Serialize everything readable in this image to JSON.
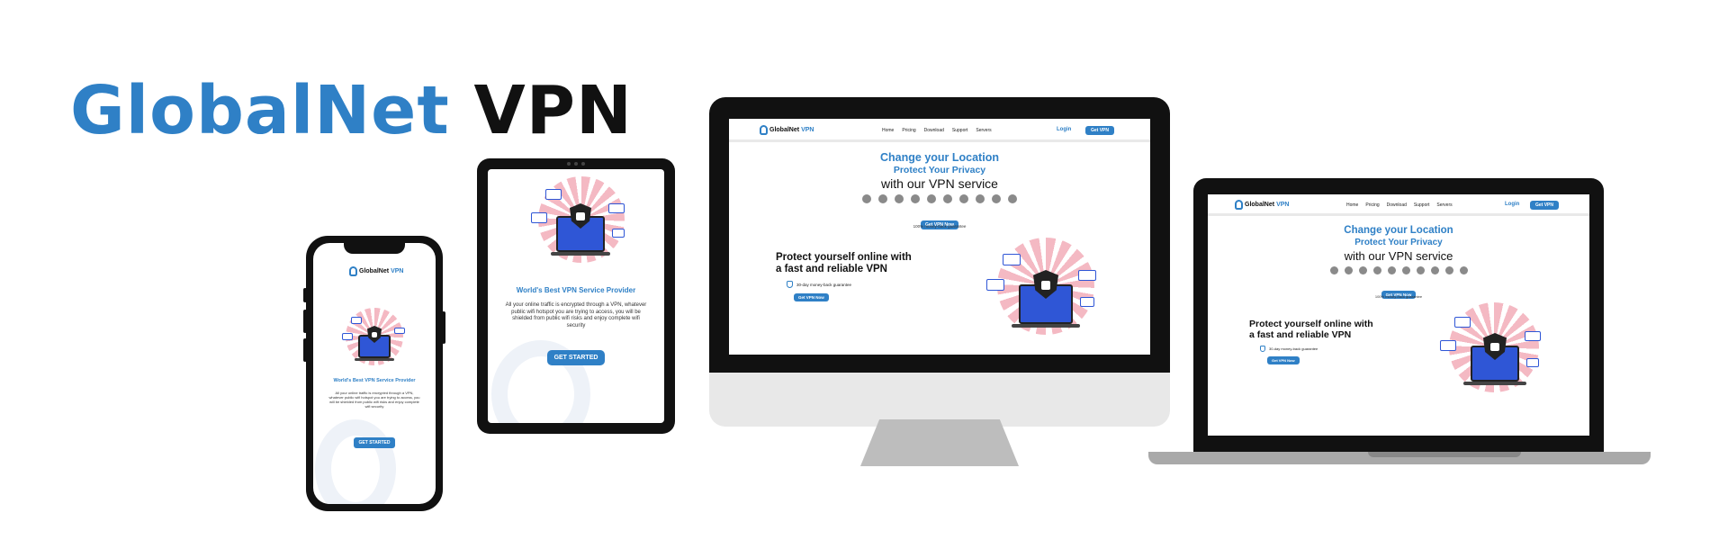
{
  "hero": {
    "brand": "GlobalNet",
    "product": "VPN"
  },
  "site": {
    "logo_brand": "GlobalNet",
    "logo_product": "VPN",
    "nav": [
      "Home",
      "Pricing",
      "Download",
      "Support",
      "Servers"
    ],
    "login": "Login",
    "get_vpn": "Get VPN",
    "headline1": "Change your Location",
    "headline2": "Protect Your Privacy",
    "headline3": "with our VPN service",
    "cta": "Get VPN Now",
    "guarantee": "100% money-back guarantee",
    "section_title_line1": "Protect yourself online with",
    "section_title_line2": "a fast and reliable VPN",
    "bullet": "30-day money-back guarantee",
    "section_cta": "Get VPN Now",
    "os_icons": [
      "windows-icon",
      "firefox-icon",
      "edge-icon",
      "skype-icon",
      "appstore-icon",
      "ie-icon",
      "safari-icon",
      "chrome-icon",
      "apple-icon",
      "android-icon"
    ]
  },
  "mobile": {
    "logo_brand": "GlobalNet",
    "logo_product": "VPN",
    "title": "World's Best VPN Service Provider",
    "body": "All your online traffic is encrypted through a VPN, whatever public wifi hotspot you are trying to access, you will be shielded from public wifi risks and enjoy complete wifi security",
    "cta": "GET STARTED"
  },
  "colors": {
    "accent": "#2f80c6",
    "dark": "#111111",
    "pink": "#f4b9c3",
    "laptop_blue": "#2f56d6"
  }
}
